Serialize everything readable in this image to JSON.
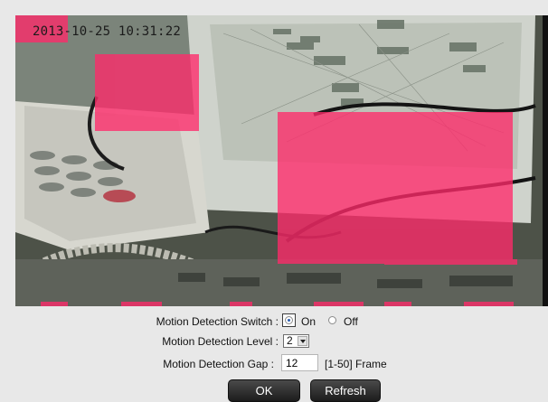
{
  "viewer": {
    "timestamp": "2013-10-25 10:31:22"
  },
  "motion": {
    "switch_label": "Motion Detection Switch :",
    "on_label": "On",
    "off_label": "Off",
    "switch_value": "On",
    "level_label": "Motion Detection Level :",
    "level_value": "2",
    "gap_label": "Motion Detection Gap :",
    "gap_value": "12",
    "gap_hint": "[1-50] Frame"
  },
  "buttons": {
    "ok_label": "OK",
    "refresh_label": "Refresh"
  },
  "colors": {
    "detection_overlay": "#ff2a6a",
    "button_dark": "#2b2b2b",
    "radio_selected": "#2a5db0"
  }
}
